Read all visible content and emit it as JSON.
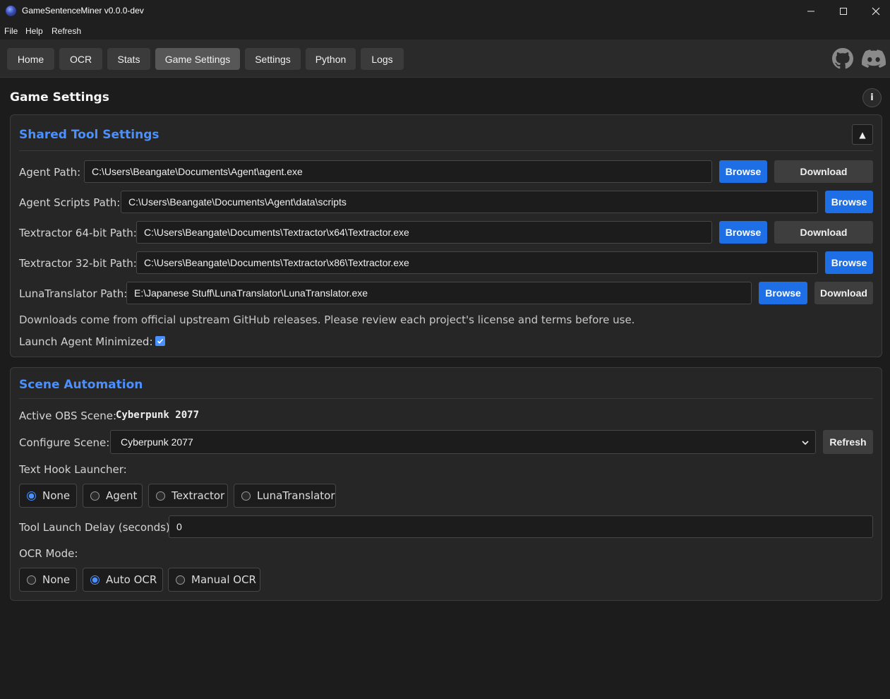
{
  "window": {
    "title": "GameSentenceMiner v0.0.0-dev"
  },
  "menu": {
    "items": [
      "File",
      "Help",
      "Refresh"
    ]
  },
  "nav": {
    "tabs": [
      "Home",
      "OCR",
      "Stats",
      "Game Settings",
      "Settings",
      "Python",
      "Logs"
    ],
    "active": "Game Settings"
  },
  "page": {
    "title": "Game Settings",
    "info_label": "i"
  },
  "shared": {
    "title": "Shared Tool Settings",
    "collapse_glyph": "▲",
    "agent_path": {
      "label": "Agent Path:",
      "value": "C:\\Users\\Beangate\\Documents\\Agent\\agent.exe"
    },
    "agent_scripts_path": {
      "label": "Agent Scripts Path:",
      "value": "C:\\Users\\Beangate\\Documents\\Agent\\data\\scripts"
    },
    "textractor64_path": {
      "label": "Textractor 64-bit Path:",
      "value": "C:\\Users\\Beangate\\Documents\\Textractor\\x64\\Textractor.exe"
    },
    "textractor32_path": {
      "label": "Textractor 32-bit Path:",
      "value": "C:\\Users\\Beangate\\Documents\\Textractor\\x86\\Textractor.exe"
    },
    "luna_path": {
      "label": "LunaTranslator Path:",
      "value": "E:\\Japanese Stuff\\LunaTranslator\\LunaTranslator.exe"
    },
    "browse_label": "Browse",
    "download_label": "Download",
    "note": "Downloads come from official upstream GitHub releases. Please review each project's license and terms before use.",
    "launch_minimized": {
      "label": "Launch Agent Minimized:",
      "checked": true
    }
  },
  "scene": {
    "title": "Scene Automation",
    "active_label": "Active OBS Scene:",
    "active_value": "Cyberpunk 2077",
    "configure_label": "Configure Scene:",
    "configure_value": "Cyberpunk 2077",
    "refresh_label": "Refresh",
    "launcher_label": "Text Hook Launcher:",
    "launcher_options": [
      "None",
      "Agent",
      "Textractor",
      "LunaTranslator"
    ],
    "launcher_selected": "None",
    "delay_label": "Tool Launch Delay (seconds):",
    "delay_value": "0",
    "ocr_label": "OCR Mode:",
    "ocr_options": [
      "None",
      "Auto OCR",
      "Manual OCR"
    ],
    "ocr_selected": "Auto OCR"
  },
  "colors": {
    "accent": "#4a90ff",
    "browse": "#1e6fe6",
    "bg": "#1c1c1c",
    "panel": "#262626"
  }
}
